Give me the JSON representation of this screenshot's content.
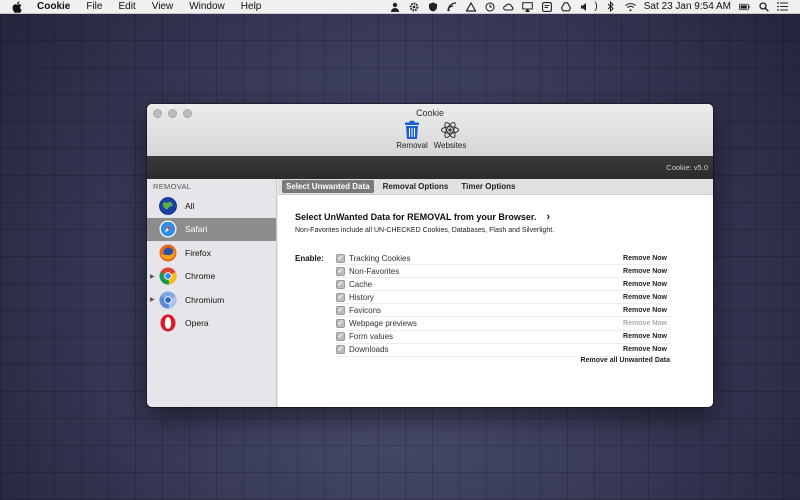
{
  "menubar": {
    "app_name": "Cookie",
    "menus": [
      "File",
      "Edit",
      "View",
      "Window",
      "Help"
    ],
    "volume_text": ")",
    "datetime": "Sat 23 Jan  9:54 AM"
  },
  "window": {
    "title": "Cookie",
    "toolbar": [
      {
        "label": "Removal",
        "icon": "trash-icon"
      },
      {
        "label": "Websites",
        "icon": "atom-icon"
      }
    ],
    "version": "Cookie: v5.0"
  },
  "sidebar": {
    "header": "REMOVAL",
    "items": [
      {
        "label": "All",
        "icon": "globe-icon"
      },
      {
        "label": "Safari",
        "icon": "safari-icon",
        "selected": true
      },
      {
        "label": "Firefox",
        "icon": "firefox-icon"
      },
      {
        "label": "Chrome",
        "icon": "chrome-icon",
        "expandable": true
      },
      {
        "label": "Chromium",
        "icon": "chromium-icon",
        "expandable": true
      },
      {
        "label": "Opera",
        "icon": "opera-icon"
      }
    ]
  },
  "tabs": [
    {
      "label": "Select Unwanted Data",
      "active": true
    },
    {
      "label": "Removal Options"
    },
    {
      "label": "Timer Options"
    }
  ],
  "main": {
    "heading": "Select UnWanted Data for REMOVAL from your Browser.",
    "subtext": "Non-Favorites include all UN-CHECKED Cookies, Databases, Flash and Silverlight.",
    "enable_label": "Enable:",
    "options": [
      {
        "label": "Tracking Cookies",
        "checked": true,
        "action": "Remove Now",
        "enabled": true
      },
      {
        "label": "Non-Favorites",
        "checked": true,
        "action": "Remove Now",
        "enabled": true
      },
      {
        "label": "Cache",
        "checked": true,
        "action": "Remove Now",
        "enabled": true
      },
      {
        "label": "History",
        "checked": true,
        "action": "Remove Now",
        "enabled": true
      },
      {
        "label": "Favicons",
        "checked": true,
        "action": "Remove Now",
        "enabled": true
      },
      {
        "label": "Webpage previews",
        "checked": true,
        "action": "Remove Now",
        "enabled": false
      },
      {
        "label": "Form values",
        "checked": true,
        "action": "Remove Now",
        "enabled": true
      },
      {
        "label": "Downloads",
        "checked": true,
        "action": "Remove Now",
        "enabled": true
      }
    ],
    "checkmark": "✓",
    "remove_all": "Remove all Unwanted Data"
  },
  "colors": {
    "selected_row": "#8c8c8c",
    "active_tab": "#7a7a7a",
    "version_bar": "#2f2f2f",
    "desktop": "#3b3d5c"
  }
}
